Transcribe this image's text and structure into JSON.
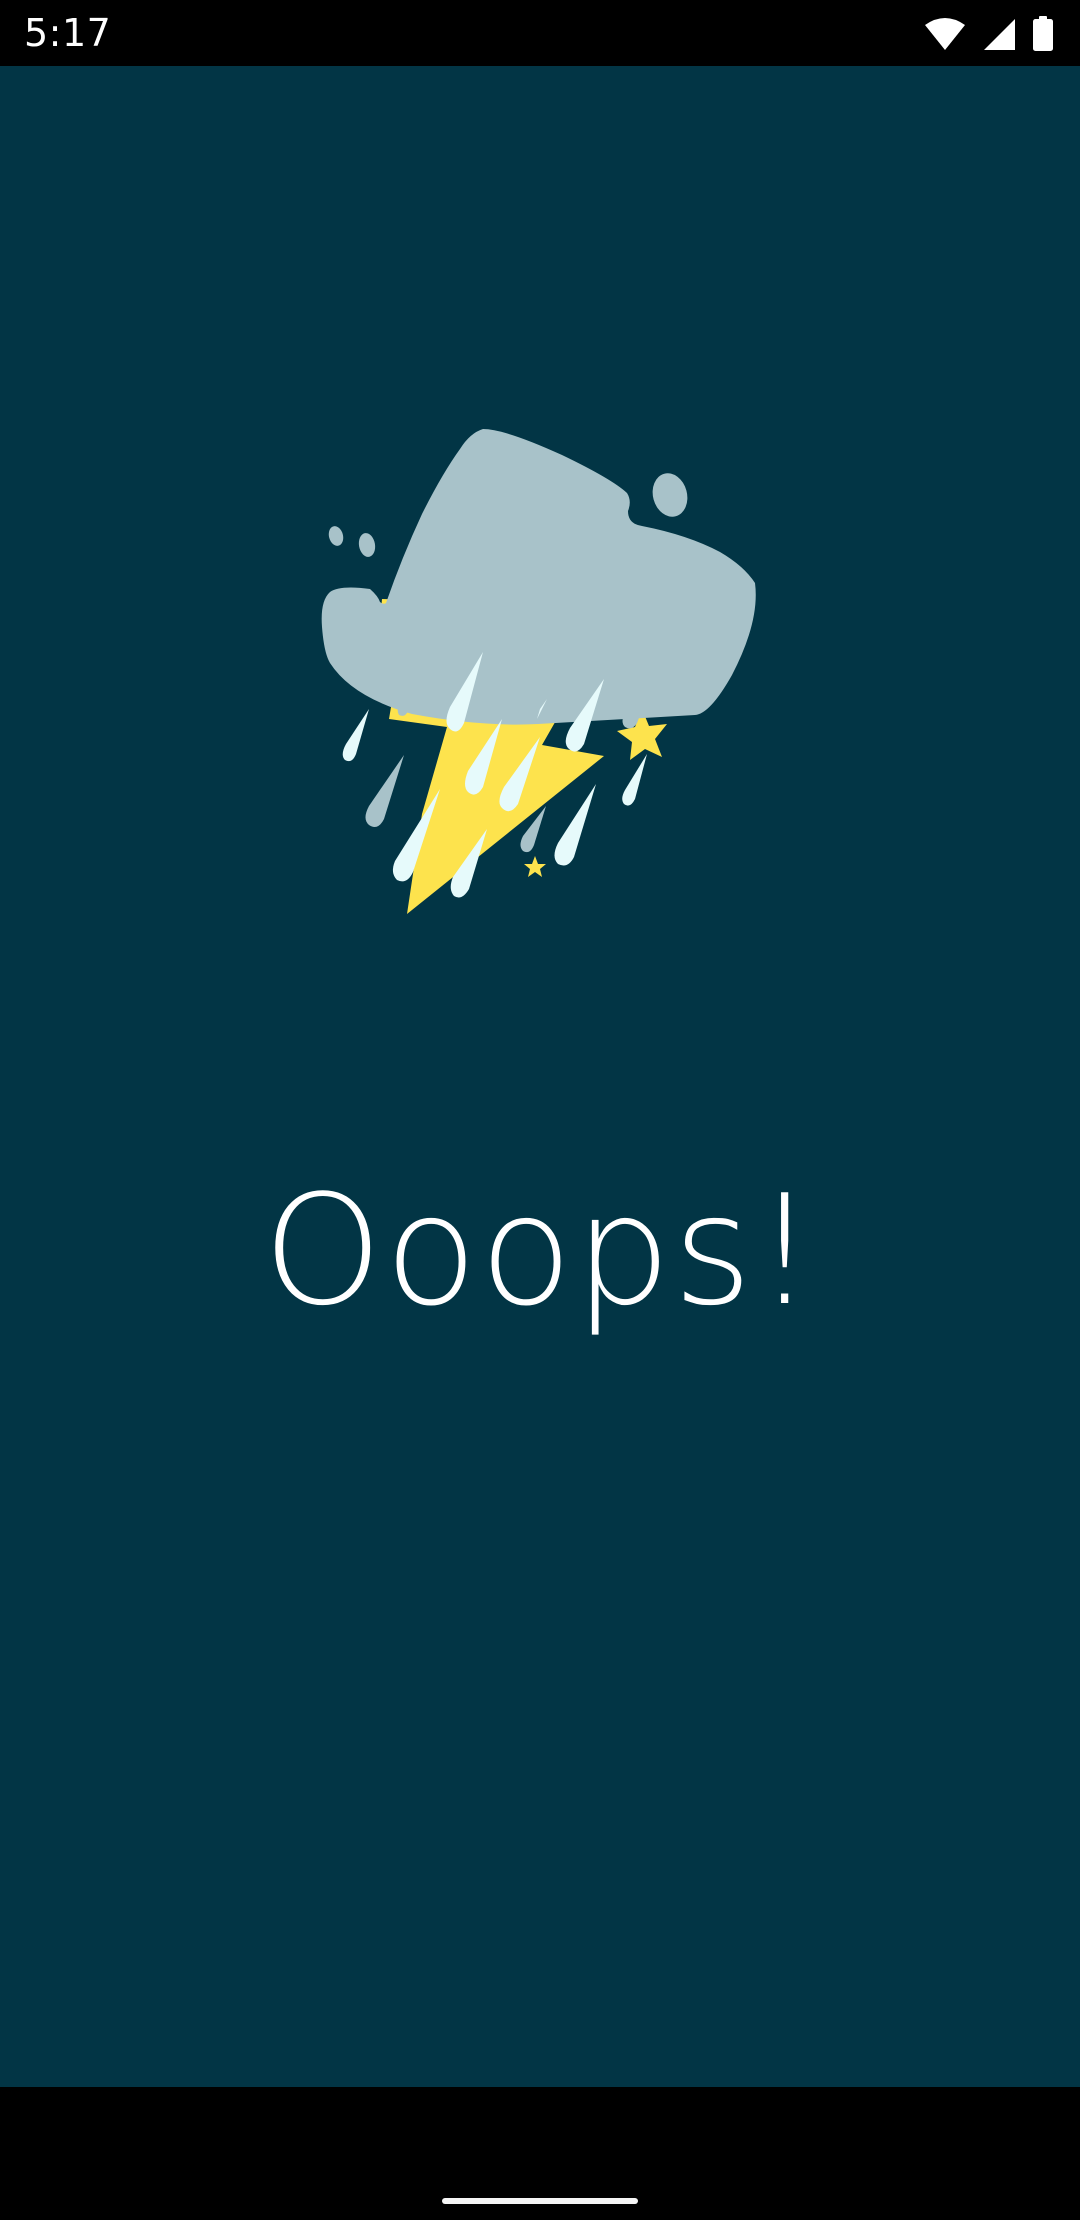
{
  "status_bar": {
    "time": "5:17",
    "icons": [
      "wifi-icon",
      "cellular-signal-icon",
      "battery-icon"
    ]
  },
  "main": {
    "illustration": "storm-cloud-with-lightning-and-rain",
    "message": "Ooops!"
  },
  "navigation_bar": {
    "handle": "home-gesture-handle"
  },
  "colors": {
    "background": "#023545",
    "cloud": "#a8c2c9",
    "lightning": "#fde34d",
    "raindrop": "#e6fafb",
    "text": "#ffffff"
  }
}
